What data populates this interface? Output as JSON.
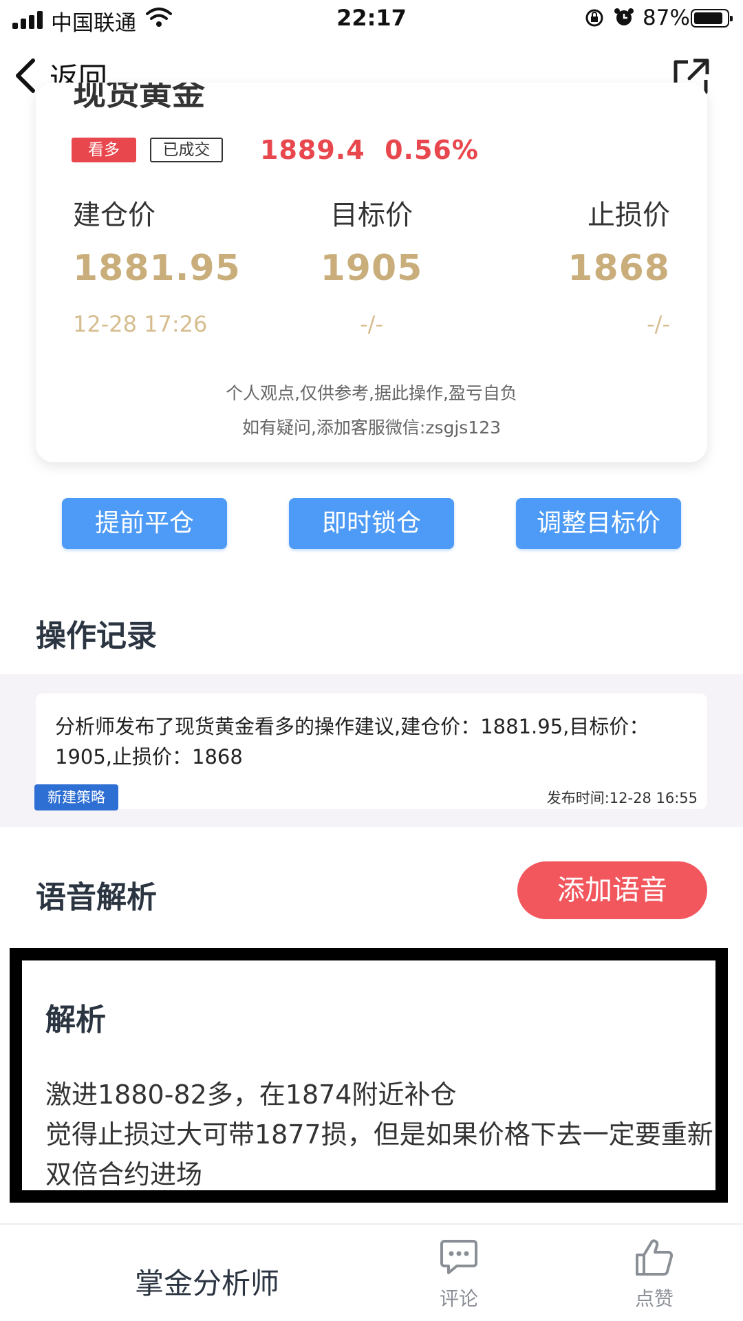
{
  "status_bar": {
    "carrier": "中国联通",
    "time": "22:17",
    "battery": "87%"
  },
  "nav": {
    "back_label": "返回"
  },
  "card": {
    "cut_title": "现货黄金",
    "badge_bull": "看多",
    "badge_done": "已成交",
    "price": "1889.4",
    "change": "0.56%",
    "columns": [
      {
        "label": "建仓价",
        "value": "1881.95",
        "sub": "12-28 17:26"
      },
      {
        "label": "目标价",
        "value": "1905",
        "sub": "-/-"
      },
      {
        "label": "止损价",
        "value": "1868",
        "sub": "-/-"
      }
    ],
    "disclaimer_1": "个人观点,仅供参考,据此操作,盈亏自负",
    "disclaimer_2": "如有疑问,添加客服微信:zsgjs123"
  },
  "actions": {
    "close_early": "提前平仓",
    "lock_now": "即时锁仓",
    "adjust_target": "调整目标价"
  },
  "log": {
    "title": "操作记录",
    "text": "分析师发布了现货黄金看多的操作建议,建仓价：1881.95,目标价：1905,止损价：1868",
    "badge": "新建策略",
    "time": "发布时间:12-28 16:55"
  },
  "voice": {
    "title": "语音解析",
    "add_button": "添加语音"
  },
  "analysis": {
    "title": "解析",
    "line_1": "激进1880-82多，在1874附近补仓",
    "line_2": "觉得止损过大可带1877损，但是如果价格下去一定要重新双倍合约进场"
  },
  "bottom": {
    "analyst": "掌金分析师",
    "comment": "评论",
    "like": "点赞"
  },
  "colors": {
    "gold": "#c9ae7b",
    "red": "#e9474e",
    "blue": "#4d9bf6",
    "badge_blue": "#2e6fd4"
  }
}
